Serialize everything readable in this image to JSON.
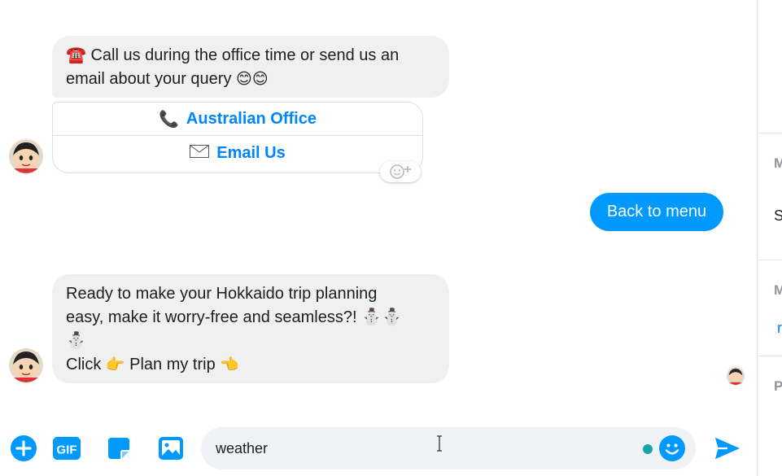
{
  "messages": {
    "bubble1": {
      "line1": "☎️ Call us during the office time or send us an",
      "line2_text": "email about your query ",
      "line2_emoji": "😊😊"
    },
    "buttons": {
      "office_icon": "📞",
      "office_label": "Australian Office",
      "email_icon": "✉️",
      "email_label": "Email Us"
    },
    "sent_reply": "Back to menu",
    "bubble2": {
      "line1": "Ready to make your Hokkaido trip planning",
      "line2": "easy, make it worry-free and seamless?! ⛄⛄",
      "line3": "⛄",
      "line4_a": "Click ",
      "line4_emoji1": "👉",
      "line4_b": " Plan my trip ",
      "line4_emoji2": "👈"
    }
  },
  "composer": {
    "input_value": "weather",
    "icons": [
      "plus-icon",
      "gif-icon",
      "sticker-icon",
      "photo-icon",
      "emoji-icon",
      "send-icon"
    ]
  },
  "right_panel": {
    "heading1": "M",
    "body1": "S",
    "heading2": "M",
    "link1": "r",
    "heading3": "P"
  },
  "colors": {
    "accent": "#0099ff",
    "bubble_bg": "#f0f0f0",
    "link": "#0084ff"
  }
}
